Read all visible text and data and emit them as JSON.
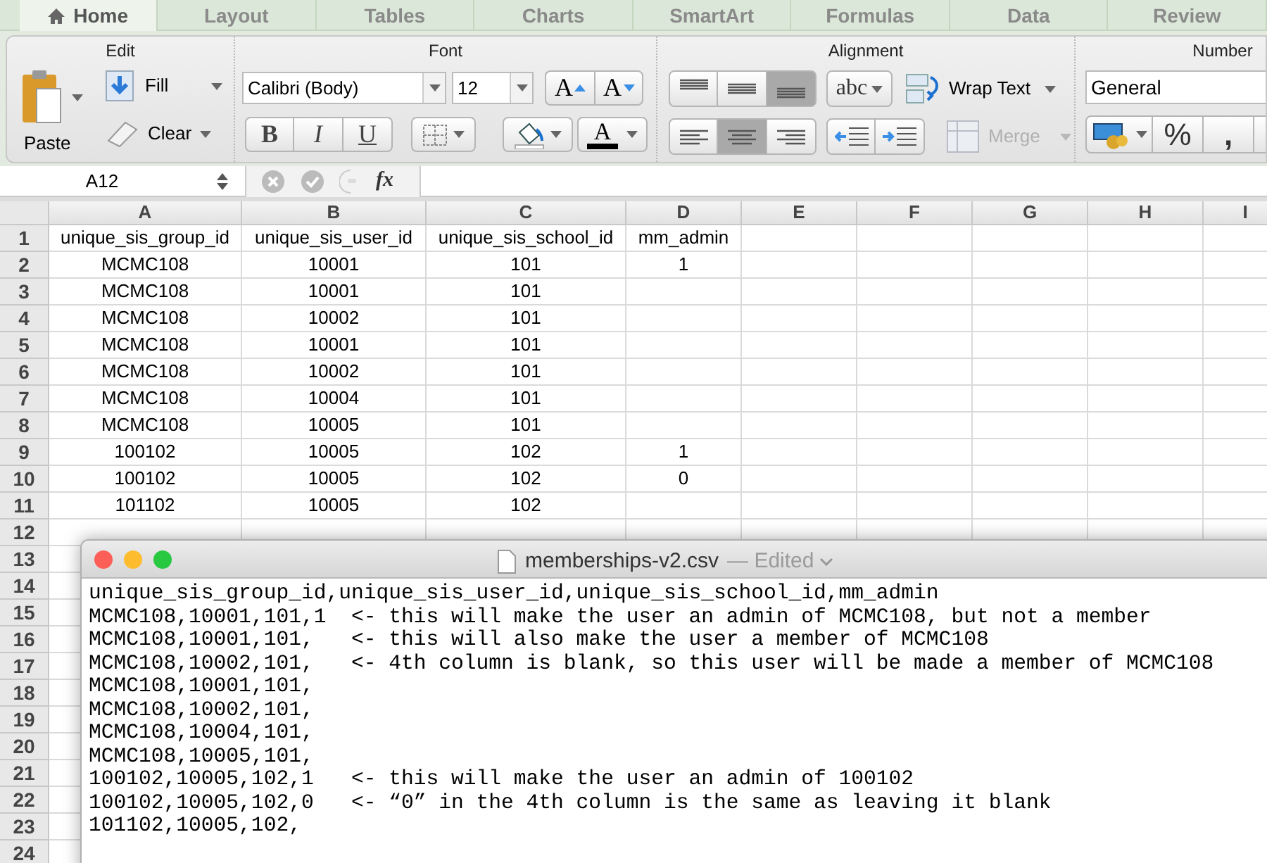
{
  "ribbon_tabs": [
    {
      "label": "Home",
      "selected": true
    },
    {
      "label": "Layout",
      "selected": false
    },
    {
      "label": "Tables",
      "selected": false
    },
    {
      "label": "Charts",
      "selected": false
    },
    {
      "label": "SmartArt",
      "selected": false
    },
    {
      "label": "Formulas",
      "selected": false
    },
    {
      "label": "Data",
      "selected": false
    },
    {
      "label": "Review",
      "selected": false
    }
  ],
  "edit_group": {
    "title": "Edit",
    "paste": "Paste",
    "fill": "Fill",
    "clear": "Clear"
  },
  "font_group": {
    "title": "Font",
    "font_name": "Calibri (Body)",
    "font_size": "12",
    "grow": "A",
    "shrink": "A",
    "bold": "B",
    "italic": "I",
    "underline": "U",
    "font_color": "A"
  },
  "alignment_group": {
    "title": "Alignment",
    "vertical": [
      {
        "selected": false
      },
      {
        "selected": false
      },
      {
        "selected": true
      }
    ],
    "orientation": "abc",
    "wrap_text": "Wrap Text",
    "horizontal": [
      {
        "selected": false
      },
      {
        "selected": true
      },
      {
        "selected": false
      }
    ],
    "merge": {
      "label": "Merge",
      "disabled": true
    }
  },
  "number_group": {
    "title": "Number",
    "format": "General",
    "percent": "%",
    "comma": ","
  },
  "formula_bar": {
    "name_box": "A12",
    "fx": "fx"
  },
  "sheet": {
    "columns": [
      "A",
      "B",
      "C",
      "D",
      "E",
      "F",
      "G",
      "H",
      "I"
    ],
    "rows": [
      {
        "number": "1",
        "A": "unique_sis_group_id",
        "B": "unique_sis_user_id",
        "C": "unique_sis_school_id",
        "D": "mm_admin"
      },
      {
        "number": "2",
        "A": "MCMC108",
        "B": "10001",
        "C": "101",
        "D": "1"
      },
      {
        "number": "3",
        "A": "MCMC108",
        "B": "10001",
        "C": "101"
      },
      {
        "number": "4",
        "A": "MCMC108",
        "B": "10002",
        "C": "101"
      },
      {
        "number": "5",
        "A": "MCMC108",
        "B": "10001",
        "C": "101"
      },
      {
        "number": "6",
        "A": "MCMC108",
        "B": "10002",
        "C": "101"
      },
      {
        "number": "7",
        "A": "MCMC108",
        "B": "10004",
        "C": "101"
      },
      {
        "number": "8",
        "A": "MCMC108",
        "B": "10005",
        "C": "101"
      },
      {
        "number": "9",
        "A": "100102",
        "B": "10005",
        "C": "102",
        "D": "1"
      },
      {
        "number": "10",
        "A": "100102",
        "B": "10005",
        "C": "102",
        "D": "0"
      },
      {
        "number": "11",
        "A": "101102",
        "B": "10005",
        "C": "102"
      },
      {
        "number": "12"
      },
      {
        "number": "13"
      },
      {
        "number": "14"
      },
      {
        "number": "15"
      },
      {
        "number": "16"
      },
      {
        "number": "17"
      },
      {
        "number": "18"
      },
      {
        "number": "19"
      },
      {
        "number": "20"
      },
      {
        "number": "21"
      },
      {
        "number": "22"
      },
      {
        "number": "23"
      },
      {
        "number": "24"
      }
    ]
  },
  "text_window": {
    "filename": "memberships-v2.csv",
    "status": "— Edited",
    "lines": [
      "unique_sis_group_id,unique_sis_user_id,unique_sis_school_id,mm_admin",
      "MCMC108,10001,101,1  <- this will make the user an admin of MCMC108, but not a member",
      "MCMC108,10001,101,   <- this will also make the user a member of MCMC108",
      "MCMC108,10002,101,   <- 4th column is blank, so this user will be made a member of MCMC108",
      "MCMC108,10001,101,",
      "MCMC108,10002,101,",
      "MCMC108,10004,101,",
      "MCMC108,10005,101,",
      "100102,10005,102,1   <- this will make the user an admin of 100102",
      "100102,10005,102,0   <- “0” in the 4th column is the same as leaving it blank",
      "101102,10005,102,"
    ]
  }
}
